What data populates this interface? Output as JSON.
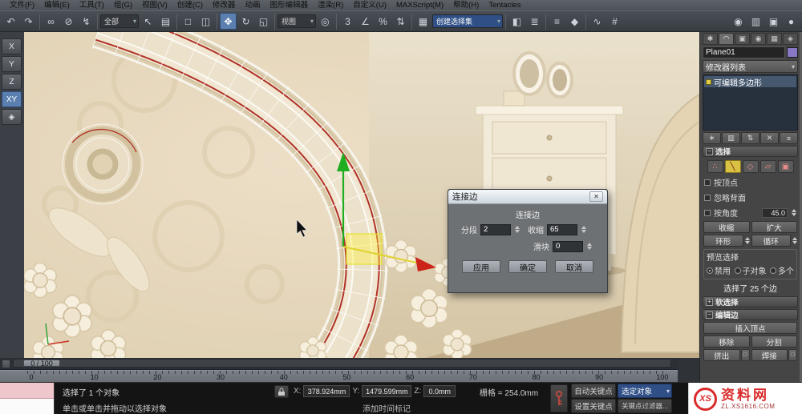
{
  "menubar": {
    "items": [
      "文件(F)",
      "编辑(E)",
      "工具(T)",
      "组(G)",
      "视图(V)",
      "创建(C)",
      "修改器",
      "动画",
      "图形编辑器",
      "渲染(R)",
      "自定义(U)",
      "MAXScript(M)",
      "帮助(H)",
      "Tentacles"
    ]
  },
  "toolbar": {
    "g1": [
      {
        "n": "undo-icon",
        "g": "↶"
      },
      {
        "n": "redo-icon",
        "g": "↷"
      }
    ],
    "g2": [
      {
        "n": "select-and-link-icon",
        "g": "∞"
      },
      {
        "n": "unlink-selection-icon",
        "g": "⊘"
      },
      {
        "n": "bind-to-spacewarp-icon",
        "g": "↯"
      }
    ],
    "g3": [
      {
        "n": "selection-filter-dropdown",
        "g": "全部",
        "cls": "dd"
      },
      {
        "n": "select-object-icon",
        "g": "↖"
      },
      {
        "n": "select-by-name-icon",
        "g": "▤"
      }
    ],
    "g4": [
      {
        "n": "rectangular-region-icon",
        "g": "□"
      },
      {
        "n": "window-crossing-icon",
        "g": "◫"
      }
    ],
    "g5": [
      {
        "n": "select-and-move-icon",
        "g": "✥",
        "cls": "active"
      },
      {
        "n": "select-and-rotate-icon",
        "g": "↻"
      },
      {
        "n": "select-and-scale-icon",
        "g": "◱"
      }
    ],
    "g6": [
      {
        "n": "reference-coordinate-dropdown",
        "g": "视图",
        "cls": "dd"
      },
      {
        "n": "use-pivot-center-icon",
        "g": "◎"
      }
    ],
    "g7": [
      {
        "n": "snaps-toggle-icon",
        "g": "3"
      },
      {
        "n": "angle-snap-icon",
        "g": "∠"
      },
      {
        "n": "percent-snap-icon",
        "g": "%"
      },
      {
        "n": "spinner-snap-icon",
        "g": "⇅"
      }
    ],
    "g8": [
      {
        "n": "edit-named-sets-icon",
        "g": "▦"
      },
      {
        "n": "named-selection-sets-dropdown",
        "g": "创建选择集",
        "cls": "dd ddwide hl"
      }
    ],
    "g9": [
      {
        "n": "mirror-icon",
        "g": "◧"
      },
      {
        "n": "align-icon",
        "g": "≣"
      }
    ],
    "g10": [
      {
        "n": "layer-manager-icon",
        "g": "≡"
      },
      {
        "n": "ribbon-toggle-icon",
        "g": "◆"
      }
    ],
    "g11": [
      {
        "n": "curve-editor-icon",
        "g": "∿"
      },
      {
        "n": "schematic-view-icon",
        "g": "#"
      }
    ],
    "g12": [
      {
        "n": "material-editor-icon",
        "g": "◉"
      },
      {
        "n": "render-setup-icon",
        "g": "▥"
      },
      {
        "n": "rendered-frame-icon",
        "g": "▣"
      },
      {
        "n": "render-production-icon",
        "g": "●"
      }
    ]
  },
  "axis_toolbar": {
    "items": [
      {
        "n": "constraint-x-button",
        "g": "X"
      },
      {
        "n": "constraint-y-button",
        "g": "Y"
      },
      {
        "n": "constraint-z-button",
        "g": "Z"
      },
      {
        "n": "constraint-xy-button",
        "g": "XY",
        "cls": "active"
      },
      {
        "n": "constraint-plane-icon",
        "g": "◈"
      }
    ]
  },
  "dialog": {
    "title": "连接边",
    "close_glyph": "✕",
    "heading": "连接边",
    "segments_label": "分段",
    "segments_value": "2",
    "pinch_label": "收缩",
    "pinch_value": "65",
    "slide_label": "滑块",
    "slide_value": "0",
    "apply": "应用",
    "ok": "确定",
    "cancel": "取消"
  },
  "command_panel": {
    "tabs": [
      {
        "n": "tab-create-icon",
        "g": "✱"
      },
      {
        "n": "tab-modify-icon",
        "g": "◠",
        "cls": "active"
      },
      {
        "n": "tab-hierarchy-icon",
        "g": "▣"
      },
      {
        "n": "tab-motion-icon",
        "g": "◉"
      },
      {
        "n": "tab-display-icon",
        "g": "▦"
      },
      {
        "n": "tab-utilities-icon",
        "g": "◈"
      }
    ],
    "object_name": "Plane01",
    "modifier_list_label": "修改器列表",
    "stack_item": "可编辑多边形",
    "stack_buttons": [
      {
        "n": "pin-stack-icon",
        "g": "∗"
      },
      {
        "n": "show-end-result-icon",
        "g": "▥"
      },
      {
        "n": "make-unique-icon",
        "g": "⇅"
      },
      {
        "n": "remove-modifier-icon",
        "g": "✕"
      },
      {
        "n": "configure-modifier-sets-icon",
        "g": "≡"
      }
    ],
    "collapse_glyph": "−",
    "expand_glyph": "+",
    "rollout_selection": "选择",
    "subobject_icons": [
      {
        "n": "vertex-subobject-icon",
        "g": "∴"
      },
      {
        "n": "edge-subobject-icon",
        "g": "╲",
        "cls": "active"
      },
      {
        "n": "border-subobject-icon",
        "g": "◇"
      },
      {
        "n": "polygon-subobject-icon",
        "g": "▱"
      },
      {
        "n": "element-subobject-icon",
        "g": "▣"
      }
    ],
    "cb_by_vertex": "按顶点",
    "cb_ignore_backfacing": "忽略背面",
    "cb_by_angle": "按角度",
    "by_angle_value": "45.0",
    "btn_shrink": "收缩",
    "btn_grow": "扩大",
    "btn_ring": "环形",
    "btn_loop": "循环",
    "preview_label": "预览选择",
    "radio_disabled": "禁用",
    "radio_subobject": "子对象",
    "radio_multiple": "多个",
    "selection_status": "选择了 25 个边",
    "rollout_soft_selection": "软选择",
    "rollout_edit_edges": "编辑边",
    "btn_insert_vertex": "插入顶点",
    "btn_remove": "移除",
    "btn_split": "分割",
    "btn_extrude": "挤出",
    "btn_weld": "焊接"
  },
  "timeline": {
    "slider_label": "0 / 100",
    "ticks": [
      "0",
      "10",
      "20",
      "30",
      "40",
      "50",
      "60",
      "70",
      "80",
      "90",
      "100"
    ]
  },
  "status_bar": {
    "selected_info": "选择了 1 个对象",
    "prompt": "单击或单击并拖动以选择对象",
    "add_time_tag": "添加时间标记",
    "x_label": "X:",
    "x_value": "378.924mm",
    "y_label": "Y:",
    "y_value": "1479.599mm",
    "z_label": "Z:",
    "z_value": "0.0mm",
    "grid_info": "栅格 = 254.0mm",
    "auto_key": "自动关键点",
    "selected_set": "选定对象",
    "set_key": "设置关键点",
    "key_filters": "关键点过滤器..."
  },
  "watermark": {
    "prefix": "XS",
    "brand": "资料网",
    "url": "ZL.XS1616.COM"
  },
  "colors": {
    "selection_red": "#b03226",
    "gizmo_y_green": "#1fae1f",
    "gizmo_x_red": "#cc2418",
    "gizmo_plane_yellow": "#e6e22e",
    "object_color": "#8878c3"
  }
}
